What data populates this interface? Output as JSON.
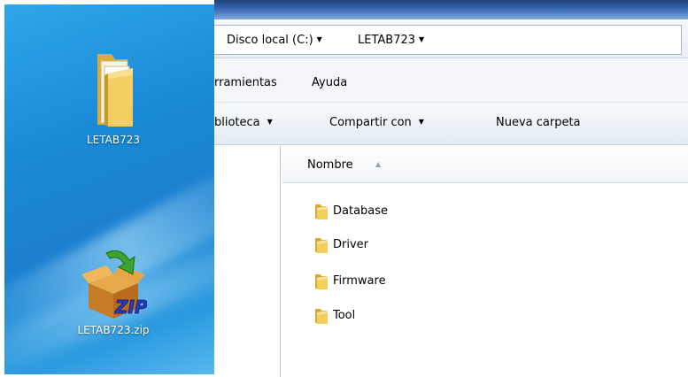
{
  "desktop": {
    "icons": [
      {
        "label": "LETAB723",
        "icon": "folder-icon"
      },
      {
        "label": "LETAB723.zip",
        "icon": "zip-archive-icon"
      }
    ]
  },
  "explorer": {
    "breadcrumb": [
      {
        "label": "Disco local (C:)"
      },
      {
        "label": "LETAB723"
      }
    ],
    "menu": [
      {
        "label": "rramientas"
      },
      {
        "label": "Ayuda"
      }
    ],
    "commands": [
      {
        "label": "blioteca"
      },
      {
        "label": "Compartir con"
      },
      {
        "label": "Nueva carpeta"
      }
    ],
    "columns": [
      {
        "label": "Nombre"
      }
    ],
    "files": [
      {
        "name": "Database",
        "icon": "folder-icon"
      },
      {
        "name": "Driver",
        "icon": "folder-icon"
      },
      {
        "name": "Firmware",
        "icon": "folder-icon"
      },
      {
        "name": "Tool",
        "icon": "folder-icon"
      }
    ]
  },
  "colors": {
    "desktop_blue": "#1b7fcf",
    "folder_yellow": "#f3cf5a",
    "titlebar_blue": "#3a68b3"
  }
}
